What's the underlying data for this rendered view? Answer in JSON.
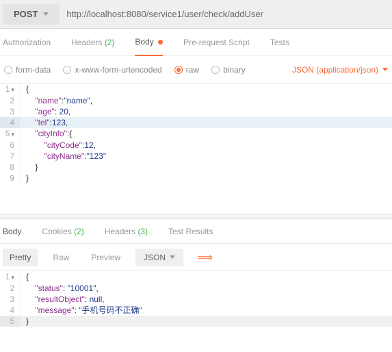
{
  "request": {
    "method": "POST",
    "url": "http://localhost:8080/service1/user/check/addUser"
  },
  "tabs": {
    "authorization": "Authorization",
    "headers": "Headers",
    "headers_count": "(2)",
    "body": "Body",
    "prerequest": "Pre-request Script",
    "tests": "Tests"
  },
  "body_opts": {
    "formdata": "form-data",
    "urlencoded": "x-www-form-urlencoded",
    "raw": "raw",
    "binary": "binary",
    "content_type": "JSON (application/json)"
  },
  "req_code": {
    "l1": "{",
    "l2_k": "\"name\"",
    "l2_v": "\"name\"",
    "l3_k": "\"age\"",
    "l3_v": "20",
    "l4_k": "\"tel\"",
    "l4_v": "123",
    "l5_k": "\"cityInfo\"",
    "l6_k": "\"cityCode\"",
    "l6_v": "12",
    "l7_k": "\"cityName\"",
    "l7_v": "\"123\"",
    "l8": "    }",
    "l9": "}"
  },
  "resp_tabs": {
    "body": "Body",
    "cookies": "Cookies",
    "cookies_count": "(2)",
    "headers": "Headers",
    "headers_count": "(3)",
    "testresults": "Test Results"
  },
  "resp_opts": {
    "pretty": "Pretty",
    "raw": "Raw",
    "preview": "Preview",
    "format": "JSON"
  },
  "resp_code": {
    "l1": "{",
    "l2_k": "\"status\"",
    "l2_v": "\"10001\"",
    "l3_k": "\"resultObject\"",
    "l3_v": "null",
    "l4_k": "\"message\"",
    "l4_v": "\"手机号码不正确\"",
    "l5": "}"
  }
}
